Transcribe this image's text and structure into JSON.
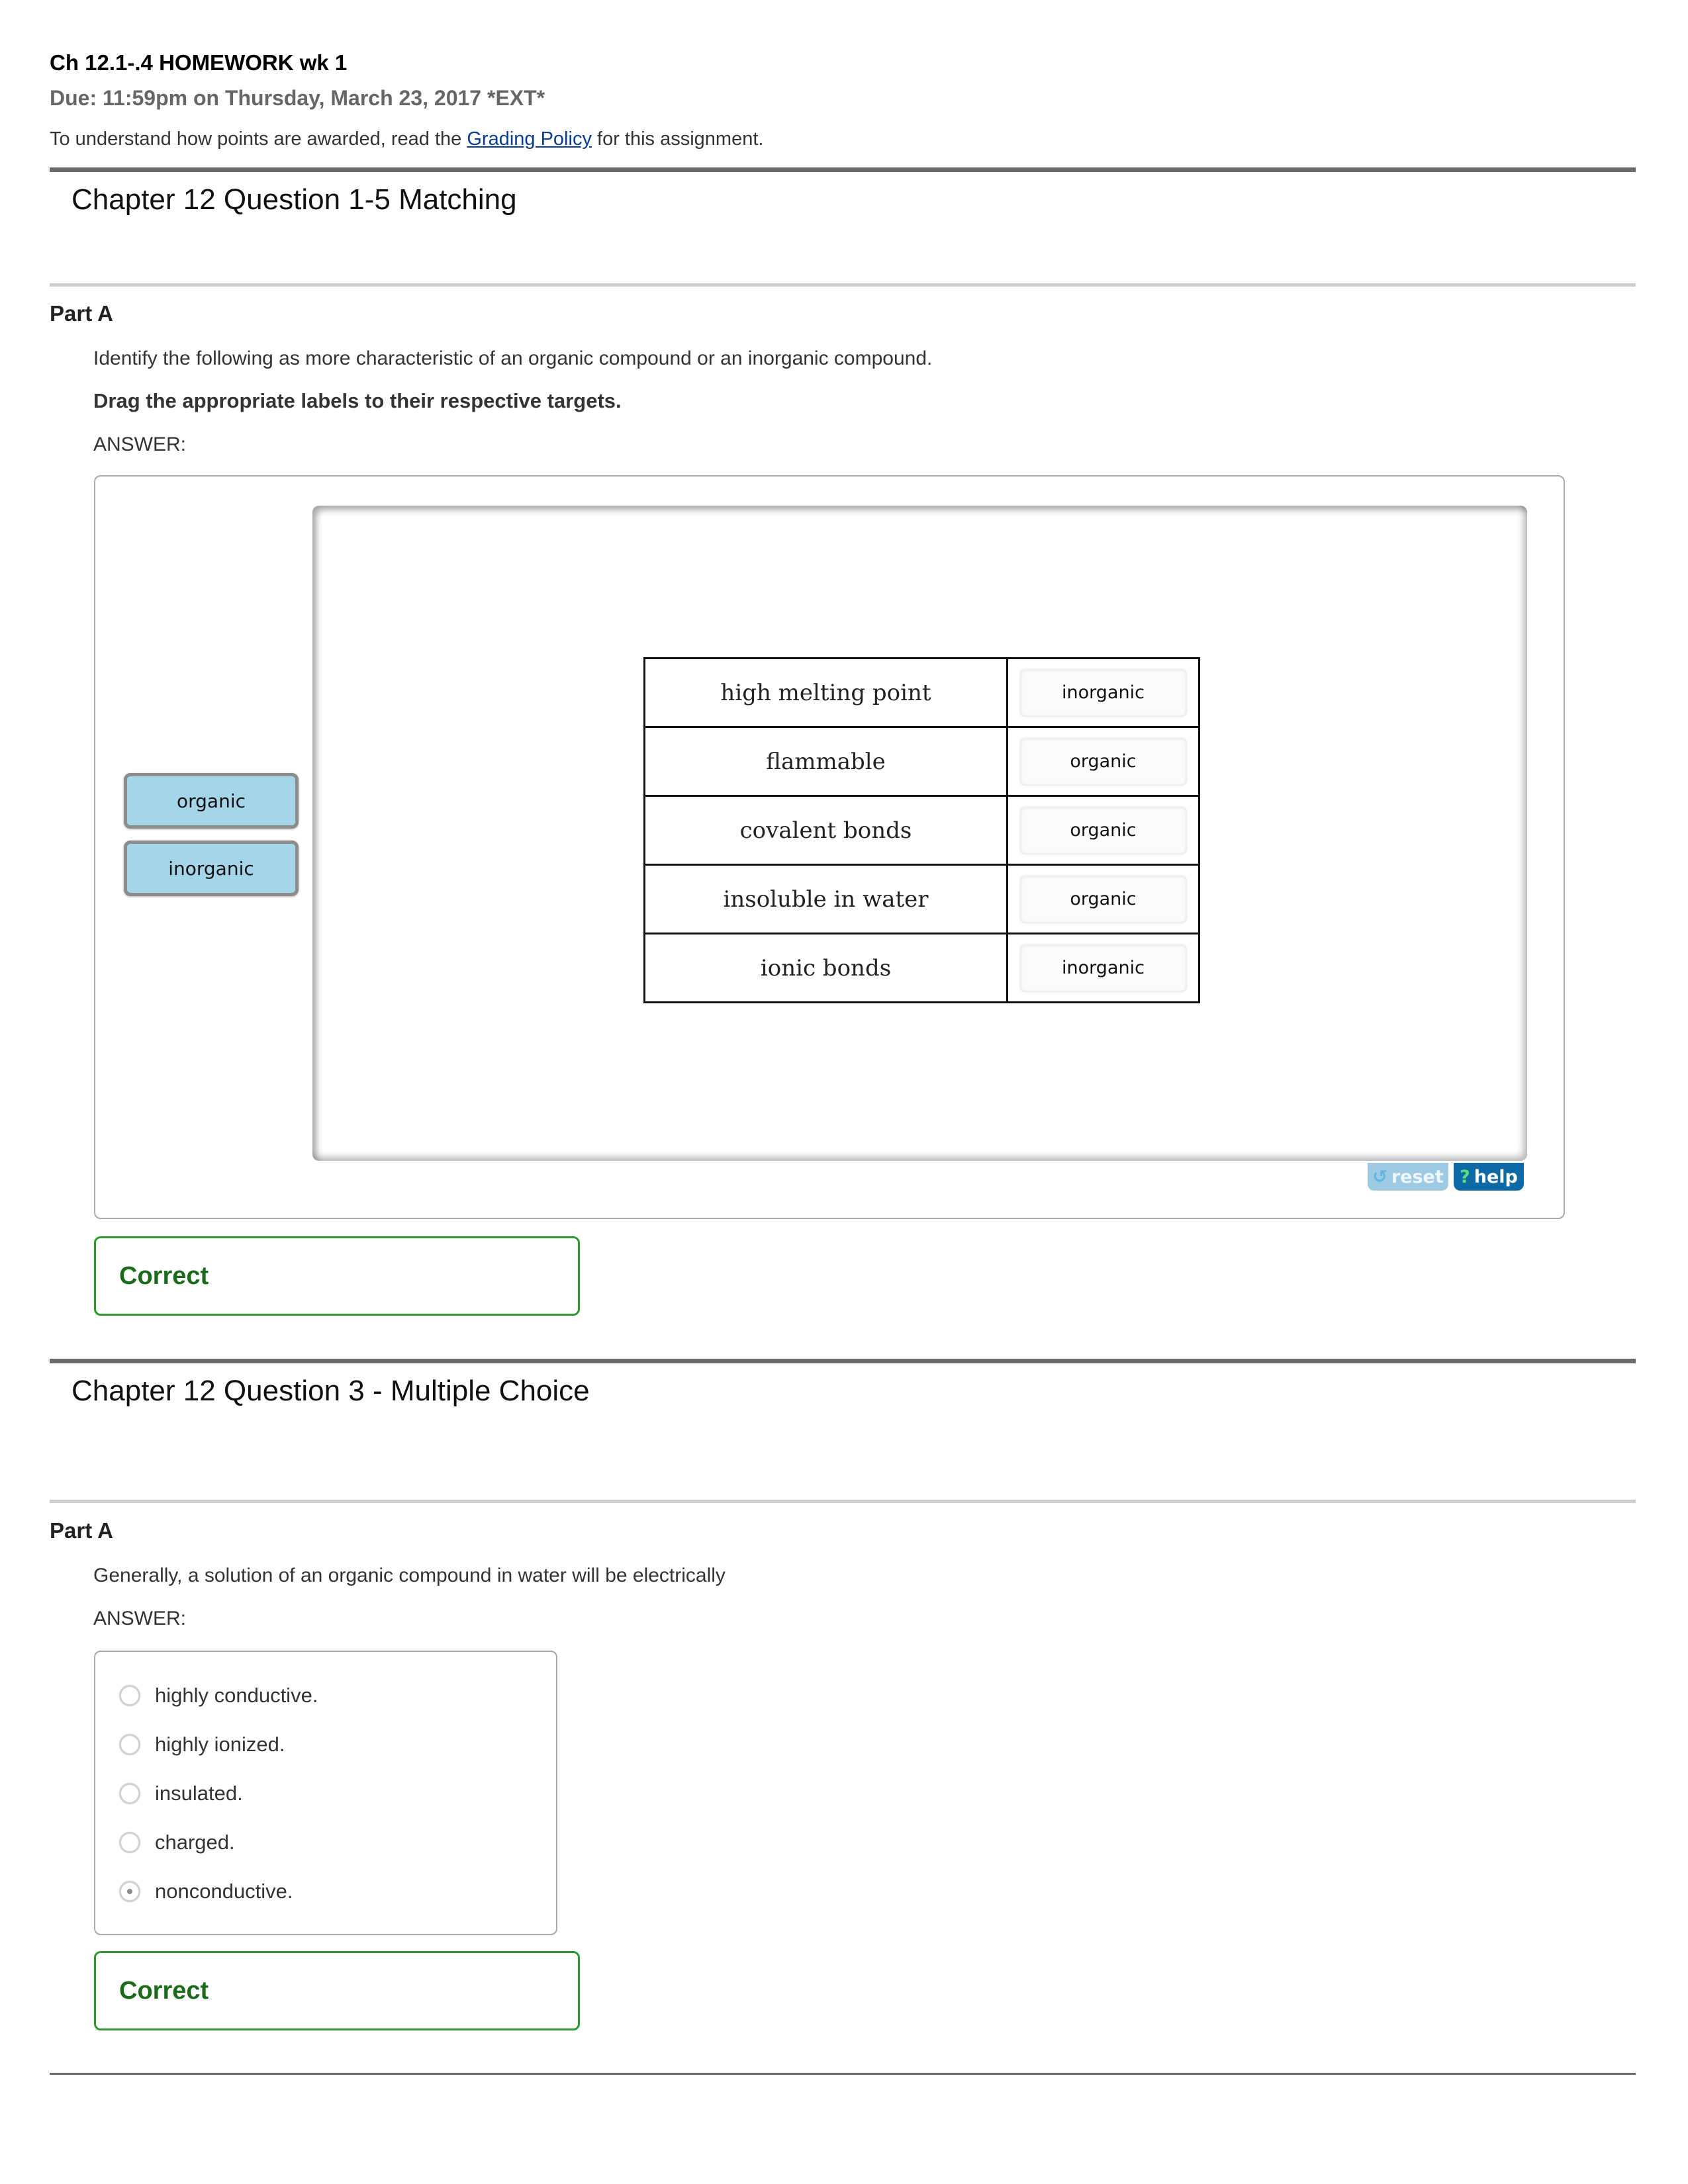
{
  "assignment": {
    "title": "Ch 12.1-.4 HOMEWORK wk 1",
    "due": "Due: 11:59pm on Thursday, March 23, 2017 *EXT*",
    "policy_prefix": "To understand how points are awarded, read the ",
    "policy_link": "Grading Policy",
    "policy_suffix": " for this assignment."
  },
  "question1": {
    "title": "Chapter 12 Question 1-5 Matching",
    "part_label": "Part A",
    "prompt": "Identify the following as more characteristic of an organic compound or an inorganic compound.",
    "instruction": "Drag the appropriate labels to their respective targets.",
    "answer_label": "ANSWER:",
    "labels": [
      "organic",
      "inorganic"
    ],
    "rows": [
      {
        "term": "high melting point",
        "answer": "inorganic"
      },
      {
        "term": "flammable",
        "answer": "organic"
      },
      {
        "term": "covalent bonds",
        "answer": "organic"
      },
      {
        "term": "insoluble in water",
        "answer": "organic"
      },
      {
        "term": "ionic bonds",
        "answer": "inorganic"
      }
    ],
    "tools": {
      "reset_label": "reset",
      "reset_icon": "↺",
      "help_label": "help",
      "help_icon": "?"
    },
    "feedback": "Correct",
    "colors": {
      "label_chip": "#a5d5e9",
      "help_button": "#0d6aa6",
      "correct": "#1a6b1a"
    }
  },
  "question2": {
    "title": "Chapter 12 Question 3 - Multiple Choice",
    "part_label": "Part A",
    "prompt": "Generally, a solution of an organic compound in water will be electrically",
    "answer_label": "ANSWER:",
    "options": [
      {
        "label": "highly conductive.",
        "selected": false
      },
      {
        "label": "highly ionized.",
        "selected": false
      },
      {
        "label": "insulated.",
        "selected": false
      },
      {
        "label": "charged.",
        "selected": false
      },
      {
        "label": "nonconductive.",
        "selected": true
      }
    ],
    "feedback": "Correct"
  }
}
